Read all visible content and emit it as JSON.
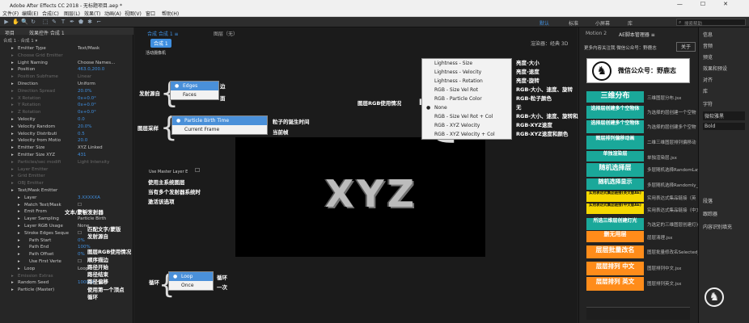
{
  "window": {
    "title": "Adobe After Effects CC 2018 - 无标题项目.aep *",
    "controls": [
      "—",
      "☐",
      "✕"
    ]
  },
  "menu": [
    "文件(F)",
    "编辑(E)",
    "合成(C)",
    "图层(L)",
    "效果(T)",
    "动画(A)",
    "视图(V)",
    "窗口",
    "帮助(H)"
  ],
  "toolbar": {
    "tools": [
      "▶",
      "✋",
      "🔍",
      "↻",
      "⬚",
      "✎",
      "T",
      "✒",
      "⬟",
      "✱",
      "⌐"
    ],
    "workspaces": [
      "默认",
      "标准",
      "小屏幕",
      "库"
    ],
    "search_placeholder": "搜索帮助"
  },
  "left": {
    "tabs": [
      "项目",
      "效果控件 合成 1"
    ],
    "subtitle": "合成 1 · 合成 1 ▾",
    "rows": [
      {
        "n": "Emitter Type",
        "v": "Text/Mask",
        "d": 0
      },
      {
        "n": "Choose Grid Emitter",
        "v": "",
        "d": 1
      },
      {
        "n": "Light Naming",
        "v": "Choose Names...",
        "d": 0
      },
      {
        "n": "Position",
        "v": "463.0,200.0",
        "d": 0
      },
      {
        "n": "Position Subframe",
        "v": "Linear",
        "d": 1
      },
      {
        "n": "Direction",
        "v": "Uniform",
        "d": 0
      },
      {
        "n": "Direction Spread",
        "v": "20.0%",
        "d": 1
      },
      {
        "n": "X Rotation",
        "v": "0x+0.0°",
        "d": 1
      },
      {
        "n": "Y Rotation",
        "v": "0x+0.0°",
        "d": 1
      },
      {
        "n": "Z Rotation",
        "v": "0x+0.0°",
        "d": 1
      },
      {
        "n": "Velocity",
        "v": "0.0",
        "d": 0
      },
      {
        "n": "Velocity Random",
        "v": "20.0%",
        "d": 0
      },
      {
        "n": "Velocity Distributi",
        "v": "0.5",
        "d": 0
      },
      {
        "n": "Velocity from Motio",
        "v": "20.0",
        "d": 0
      },
      {
        "n": "Emitter Size",
        "v": "XYZ Linked",
        "d": 0
      },
      {
        "n": "Emitter Size XYZ",
        "v": "431",
        "d": 0
      },
      {
        "n": "Particles/sec modifi",
        "v": "Light Intensity",
        "d": 1
      },
      {
        "n": "Layer Emitter",
        "v": "",
        "d": 1
      },
      {
        "n": "Grid Emitter",
        "v": "",
        "d": 1
      },
      {
        "n": "OBJ Emitter",
        "v": "",
        "d": 1
      },
      {
        "n": "Text/Mask Emitter",
        "v": "",
        "d": 0
      },
      {
        "n": "Layer",
        "v": "3.XXXXXA",
        "d": 0
      },
      {
        "n": "Match Text/Mask",
        "v": "☐",
        "d": 0
      },
      {
        "n": "Emit From",
        "v": "Edges",
        "d": 0
      },
      {
        "n": "Layer Sampling",
        "v": "Particle Birth",
        "d": 0
      },
      {
        "n": "Layer RGB Usage",
        "v": "None",
        "d": 0
      },
      {
        "n": "Stroke Edges Seque",
        "v": "☐",
        "d": 0
      },
      {
        "n": "Path Start",
        "v": "0%",
        "d": 0
      },
      {
        "n": "Path End",
        "v": "100%",
        "d": 0
      },
      {
        "n": "Path Offset",
        "v": "0%",
        "d": 0
      },
      {
        "n": "Use First Verte",
        "v": "☐",
        "d": 0
      },
      {
        "n": "Loop",
        "v": "Loop",
        "d": 0
      },
      {
        "n": "Emission Extras",
        "v": "",
        "d": 1
      },
      {
        "n": "Random Seed",
        "v": "100000",
        "d": 0
      },
      {
        "n": "Particle (Master)",
        "v": "",
        "d": 0
      }
    ]
  },
  "annotations": {
    "text_mask": "文本/蒙板发射器",
    "match": "匹配文字/蒙版",
    "emit_from": "发射源自",
    "rgb": "图层RGB使用情况",
    "stroke": "顺序描边",
    "path_start": "路径开始",
    "path_end": "路径结束",
    "path_offset": "路径偏移",
    "first_vertex": "使用第一个顶点",
    "loop": "循环",
    "emit_src": "发射源自",
    "sampling": "图层采样",
    "rgb_use": "图层RGB使用情况",
    "birth": "粒子的诞生时间",
    "current": "当前帧",
    "edges": "边",
    "faces": "面",
    "loop2": "循环",
    "once": "一次",
    "master_help": [
      "使用主系统图层",
      "当有多个发射器系统时",
      "激活该选项"
    ]
  },
  "comp": {
    "tabs": [
      "合成 合成 1 ≡",
      "图层（无）"
    ],
    "breadcrumb": "合成 1",
    "renderer": "渲染器：经典 3D",
    "overlay_label": "活动摄像机",
    "master_label": "Use Master Layer E",
    "viewer_text": "XYZ"
  },
  "menus": {
    "emit": [
      "Edges",
      "Faces"
    ],
    "sampling": [
      "Particle Birth Time",
      "Current Frame"
    ],
    "rgb": [
      "Lightness - Size",
      "Lightness - Velocity",
      "Lightness - Rotation",
      "RGB - Size Vel Rot",
      "RGB - Particle Color",
      "None",
      "RGB - Size Vel Rot + Col",
      "RGB - XYZ Velocity",
      "RGB - XYZ Velocity + Col"
    ],
    "loop": [
      "Loop",
      "Once"
    ]
  },
  "rgb_notes": [
    "亮度-大小",
    "亮度-速度",
    "亮度-旋转",
    "RGB-大小、速度、旋转",
    "RGB-粒子颜色",
    "无",
    "RGB-大小、速度、旋转和颜色",
    "RGB-XYZ速度",
    "RGB-XYZ速度和颜色"
  ],
  "right": {
    "tabs": [
      "Motion 2",
      "AE脚本管理器 ≡"
    ],
    "promo": "更多内容关注我 微信公众号：野鹿志",
    "close": "关于",
    "wx": "微信公众号：野鹿志",
    "scripts": [
      {
        "btn": "三维分布",
        "lbl": "三维图层分布.jsx",
        "bg": "#1aa89a",
        "fs": 9
      },
      {
        "btn": "选择层创建多个空物体",
        "lbl": "为选择的层创建一个空物",
        "bg": "#1aa89a",
        "fs": 6
      },
      {
        "btn": "选择层创建多个空物体",
        "lbl": "为选择的层创建多个空物",
        "bg": "#1aa89a",
        "fs": 6
      },
      {
        "btn": "图层排列偏移动画",
        "lbl": "二维三维图层排列偏移动",
        "bg": "#1aa89a",
        "fs": 6
      },
      {
        "btn": "单独渲染层",
        "lbl": "单独渲染层.jsx",
        "bg": "#1aa89a",
        "fs": 6
      },
      {
        "btn": "随机选择层",
        "lbl": "多层随机选择RandomLaye",
        "bg": "#1aa89a",
        "fs": 8
      },
      {
        "btn": "随机选择显示",
        "lbl": "多层随机选择Randomly_",
        "bg": "#1aa89a",
        "fs": 7
      },
      {
        "btn": "实用表达式集品链接(英文版AE)",
        "lbl": "实用表达式集品链接（英",
        "bg": "#f5d800",
        "fs": 4.5
      },
      {
        "btn": "实用表达式集品链接(中文版AE)",
        "lbl": "实用表达式集品链接（中文",
        "bg": "#f5d800",
        "fs": 4.5
      },
      {
        "btn": "所选三维层创建灯光",
        "lbl": "为选定的三维图层创建灯光",
        "bg": "#1aa89a",
        "fs": 6
      },
      {
        "btn": "删无用层",
        "lbl": "层层清理.jsx",
        "bg": "#ff8c1a",
        "fs": 7
      },
      {
        "btn": "层层批量改名",
        "lbl": "图层批量修改名Selected_Laye",
        "bg": "#ff8c1a",
        "fs": 8
      },
      {
        "btn": "层层排列 中文",
        "lbl": "图层排列中文.jsx",
        "bg": "#ff8c1a",
        "fs": 7.5
      },
      {
        "btn": "层层排列 英文",
        "lbl": "图层排列英文.jsx",
        "bg": "#ff8c1a",
        "fs": 7.5
      }
    ]
  },
  "far": [
    "信息",
    "音频",
    "预览",
    "效果和预设",
    "对齐",
    "库",
    "字符",
    "微软雅黑",
    "Bold",
    "段落",
    "跟踪器",
    "内容识别填充"
  ]
}
